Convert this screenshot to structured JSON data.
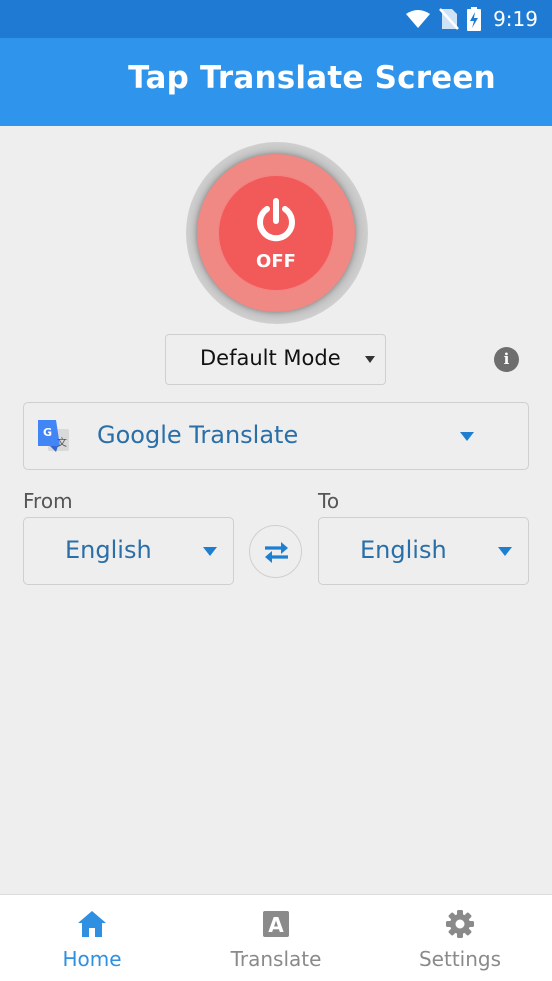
{
  "status_bar": {
    "time": "9:19",
    "icons": [
      "wifi-icon",
      "no-sim-icon",
      "battery-charging-icon"
    ]
  },
  "app_bar": {
    "title": "Tap Translate Screen"
  },
  "power_button": {
    "state_label": "OFF",
    "icon": "power-icon"
  },
  "mode_select": {
    "selected": "Default Mode"
  },
  "info_button": {
    "glyph": "i"
  },
  "engine_select": {
    "selected": "Google Translate",
    "icon": "google-translate-icon"
  },
  "language": {
    "from_label": "From",
    "to_label": "To",
    "from_value": "English",
    "to_value": "English",
    "swap_icon": "swap-arrows-icon"
  },
  "bottom_nav": {
    "items": [
      {
        "label": "Home",
        "icon": "home-icon",
        "active": true
      },
      {
        "label": "Translate",
        "icon": "translate-icon",
        "active": false
      },
      {
        "label": "Settings",
        "icon": "gear-icon",
        "active": false
      }
    ]
  },
  "colors": {
    "status_bar": "#1f7ad4",
    "app_bar": "#2f94ec",
    "power_off": "#f25a5a",
    "accent_text": "#2a6fa8",
    "nav_active": "#2f8fe0",
    "nav_inactive": "#8a8a8a"
  }
}
